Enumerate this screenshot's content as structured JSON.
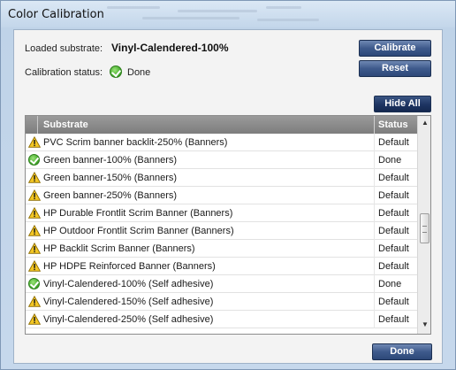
{
  "window": {
    "title": "Color Calibration"
  },
  "info": {
    "loaded_label": "Loaded substrate:",
    "loaded_value": "Vinyl-Calendered-100%",
    "status_label": "Calibration status:",
    "status_value": "Done"
  },
  "buttons": {
    "calibrate": "Calibrate",
    "reset": "Reset",
    "hide_all": "Hide All",
    "done": "Done"
  },
  "table": {
    "headers": {
      "substrate": "Substrate",
      "status": "Status"
    },
    "rows": [
      {
        "icon": "warning-icon",
        "substrate": "PVC Scrim banner backlit-250% (Banners)",
        "status": "Default"
      },
      {
        "icon": "check-icon",
        "substrate": "Green banner-100% (Banners)",
        "status": "Done"
      },
      {
        "icon": "warning-icon",
        "substrate": "Green banner-150% (Banners)",
        "status": "Default"
      },
      {
        "icon": "warning-icon",
        "substrate": "Green banner-250% (Banners)",
        "status": "Default"
      },
      {
        "icon": "warning-icon",
        "substrate": "HP Durable Frontlit Scrim Banner (Banners)",
        "status": "Default"
      },
      {
        "icon": "warning-icon",
        "substrate": "HP Outdoor Frontlit Scrim Banner (Banners)",
        "status": "Default"
      },
      {
        "icon": "warning-icon",
        "substrate": "HP Backlit Scrim Banner (Banners)",
        "status": "Default"
      },
      {
        "icon": "warning-icon",
        "substrate": "HP HDPE Reinforced Banner (Banners)",
        "status": "Default"
      },
      {
        "icon": "check-icon",
        "substrate": "Vinyl-Calendered-100% (Self adhesive)",
        "status": "Done"
      },
      {
        "icon": "warning-icon",
        "substrate": "Vinyl-Calendered-150% (Self adhesive)",
        "status": "Default"
      },
      {
        "icon": "warning-icon",
        "substrate": "Vinyl-Calendered-250% (Self adhesive)",
        "status": "Default"
      }
    ]
  },
  "colors": {
    "button_bg": "#2d4878",
    "header_bg": "#8a8a8a",
    "warning_fill": "#f3c623",
    "ok_fill": "#4cb132"
  }
}
